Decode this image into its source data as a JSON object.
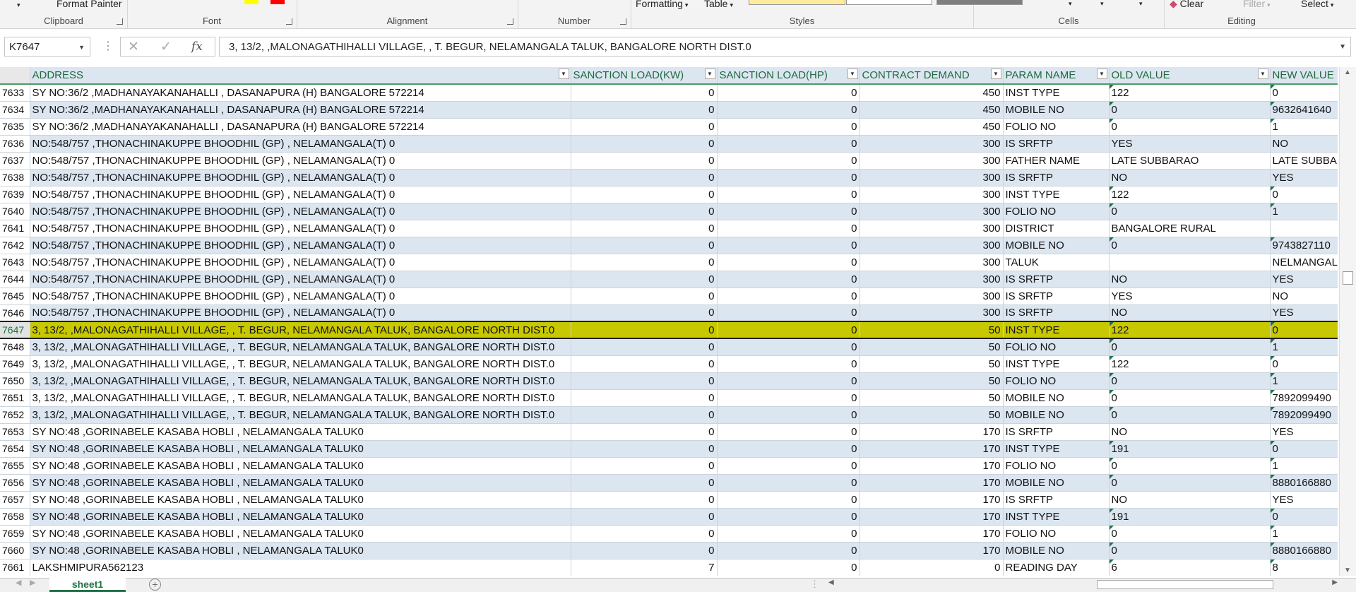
{
  "ribbon": {
    "clipboard": {
      "label": "Clipboard",
      "format_painter": "Format Painter"
    },
    "font": {
      "label": "Font"
    },
    "alignment": {
      "label": "Alignment"
    },
    "number": {
      "label": "Number"
    },
    "styles": {
      "label": "Styles",
      "conditional_formatting": "Formatting",
      "format_as_table": "Table"
    },
    "cells": {
      "label": "Cells"
    },
    "editing": {
      "label": "Editing",
      "clear": "Clear",
      "filter": "Filter",
      "select": "Select"
    }
  },
  "formula_bar": {
    "name_box": "K7647",
    "content": "3, 13/2,  ,MALONAGATHIHALLI VILLAGE,  , T. BEGUR, NELAMANGALA TALUK, BANGALORE NORTH DIST.0"
  },
  "columns": [
    "ADDRESS",
    "SANCTION LOAD(KW)",
    "SANCTION LOAD(HP)",
    "CONTRACT DEMAND",
    "PARAM NAME",
    "OLD VALUE",
    "NEW VALUE"
  ],
  "selected_row": "7647",
  "rows": [
    {
      "n": "7633",
      "addr": "SY NO:36/2  ,MADHANAYAKANAHALLI   , DASANAPURA (H) BANGALORE 572214",
      "kw": "0",
      "hp": "0",
      "cd": "450",
      "param": "INST TYPE",
      "old": "122",
      "new": "0",
      "old_txt": true,
      "new_txt": true
    },
    {
      "n": "7634",
      "addr": "SY NO:36/2  ,MADHANAYAKANAHALLI   , DASANAPURA (H) BANGALORE 572214",
      "kw": "0",
      "hp": "0",
      "cd": "450",
      "param": "MOBILE NO",
      "old": "0",
      "new": "9632641640",
      "old_txt": true,
      "new_txt": true
    },
    {
      "n": "7635",
      "addr": "SY NO:36/2  ,MADHANAYAKANAHALLI   , DASANAPURA (H) BANGALORE 572214",
      "kw": "0",
      "hp": "0",
      "cd": "450",
      "param": "FOLIO NO",
      "old": "0",
      "new": "1",
      "old_txt": true,
      "new_txt": true
    },
    {
      "n": "7636",
      "addr": "NO:548/757 ,THONACHINAKUPPE BHOODHIL (GP)  , NELAMANGALA(T) 0",
      "kw": "0",
      "hp": "0",
      "cd": "300",
      "param": "IS SRFTP",
      "old": "YES",
      "new": "NO",
      "old_txt": false,
      "new_txt": false
    },
    {
      "n": "7637",
      "addr": "NO:548/757 ,THONACHINAKUPPE BHOODHIL (GP)  , NELAMANGALA(T) 0",
      "kw": "0",
      "hp": "0",
      "cd": "300",
      "param": "FATHER NAME",
      "old": "LATE SUBBARAO",
      "new": "LATE SUBBAR",
      "old_txt": false,
      "new_txt": false
    },
    {
      "n": "7638",
      "addr": "NO:548/757 ,THONACHINAKUPPE BHOODHIL (GP)  , NELAMANGALA(T) 0",
      "kw": "0",
      "hp": "0",
      "cd": "300",
      "param": "IS SRFTP",
      "old": "NO",
      "new": "YES",
      "old_txt": false,
      "new_txt": false
    },
    {
      "n": "7639",
      "addr": "NO:548/757 ,THONACHINAKUPPE BHOODHIL (GP)  , NELAMANGALA(T) 0",
      "kw": "0",
      "hp": "0",
      "cd": "300",
      "param": "INST TYPE",
      "old": "122",
      "new": "0",
      "old_txt": true,
      "new_txt": true
    },
    {
      "n": "7640",
      "addr": "NO:548/757 ,THONACHINAKUPPE BHOODHIL (GP)  , NELAMANGALA(T) 0",
      "kw": "0",
      "hp": "0",
      "cd": "300",
      "param": "FOLIO NO",
      "old": "0",
      "new": "1",
      "old_txt": true,
      "new_txt": true
    },
    {
      "n": "7641",
      "addr": "NO:548/757 ,THONACHINAKUPPE BHOODHIL (GP)  , NELAMANGALA(T) 0",
      "kw": "0",
      "hp": "0",
      "cd": "300",
      "param": "DISTRICT",
      "old": "BANGALORE RURAL",
      "new": "",
      "old_txt": false,
      "new_txt": false
    },
    {
      "n": "7642",
      "addr": "NO:548/757 ,THONACHINAKUPPE BHOODHIL (GP)  , NELAMANGALA(T) 0",
      "kw": "0",
      "hp": "0",
      "cd": "300",
      "param": "MOBILE NO",
      "old": "0",
      "new": "9743827110",
      "old_txt": true,
      "new_txt": true
    },
    {
      "n": "7643",
      "addr": "NO:548/757 ,THONACHINAKUPPE BHOODHIL (GP)  , NELAMANGALA(T) 0",
      "kw": "0",
      "hp": "0",
      "cd": "300",
      "param": "TALUK",
      "old": "",
      "new": "NELMANGAL",
      "old_txt": false,
      "new_txt": false
    },
    {
      "n": "7644",
      "addr": "NO:548/757 ,THONACHINAKUPPE BHOODHIL (GP)  , NELAMANGALA(T) 0",
      "kw": "0",
      "hp": "0",
      "cd": "300",
      "param": "IS SRFTP",
      "old": "NO",
      "new": "YES",
      "old_txt": false,
      "new_txt": false
    },
    {
      "n": "7645",
      "addr": "NO:548/757 ,THONACHINAKUPPE BHOODHIL (GP)  , NELAMANGALA(T) 0",
      "kw": "0",
      "hp": "0",
      "cd": "300",
      "param": "IS SRFTP",
      "old": "YES",
      "new": "NO",
      "old_txt": false,
      "new_txt": false
    },
    {
      "n": "7646",
      "addr": "NO:548/757 ,THONACHINAKUPPE BHOODHIL (GP)  , NELAMANGALA(T) 0",
      "kw": "0",
      "hp": "0",
      "cd": "300",
      "param": "IS SRFTP",
      "old": "NO",
      "new": "YES",
      "old_txt": false,
      "new_txt": false
    },
    {
      "n": "7647",
      "addr": "3, 13/2,  ,MALONAGATHIHALLI VILLAGE,  , T. BEGUR, NELAMANGALA TALUK, BANGALORE NORTH DIST.0",
      "kw": "0",
      "hp": "0",
      "cd": "50",
      "param": "INST TYPE",
      "old": "122",
      "new": "0",
      "old_txt": true,
      "new_txt": true
    },
    {
      "n": "7648",
      "addr": "3, 13/2,  ,MALONAGATHIHALLI VILLAGE,  , T. BEGUR, NELAMANGALA TALUK, BANGALORE NORTH DIST.0",
      "kw": "0",
      "hp": "0",
      "cd": "50",
      "param": "FOLIO NO",
      "old": "0",
      "new": "1",
      "old_txt": true,
      "new_txt": true
    },
    {
      "n": "7649",
      "addr": "3, 13/2,  ,MALONAGATHIHALLI VILLAGE,  , T. BEGUR, NELAMANGALA TALUK, BANGALORE NORTH DIST.0",
      "kw": "0",
      "hp": "0",
      "cd": "50",
      "param": "INST TYPE",
      "old": "122",
      "new": "0",
      "old_txt": true,
      "new_txt": true
    },
    {
      "n": "7650",
      "addr": "3, 13/2,  ,MALONAGATHIHALLI VILLAGE,  , T. BEGUR, NELAMANGALA TALUK, BANGALORE NORTH DIST.0",
      "kw": "0",
      "hp": "0",
      "cd": "50",
      "param": "FOLIO NO",
      "old": "0",
      "new": "1",
      "old_txt": true,
      "new_txt": true
    },
    {
      "n": "7651",
      "addr": "3, 13/2,  ,MALONAGATHIHALLI VILLAGE,  , T. BEGUR, NELAMANGALA TALUK, BANGALORE NORTH DIST.0",
      "kw": "0",
      "hp": "0",
      "cd": "50",
      "param": "MOBILE NO",
      "old": "0",
      "new": "7892099490",
      "old_txt": true,
      "new_txt": true
    },
    {
      "n": "7652",
      "addr": "3, 13/2,  ,MALONAGATHIHALLI VILLAGE,  , T. BEGUR, NELAMANGALA TALUK, BANGALORE NORTH DIST.0",
      "kw": "0",
      "hp": "0",
      "cd": "50",
      "param": "MOBILE NO",
      "old": "0",
      "new": "7892099490",
      "old_txt": true,
      "new_txt": true
    },
    {
      "n": "7653",
      "addr": "SY NO:48  ,GORINABELE KASABA HOBLI  , NELAMANGALA TALUK0",
      "kw": "0",
      "hp": "0",
      "cd": "170",
      "param": "IS SRFTP",
      "old": "NO",
      "new": "YES",
      "old_txt": false,
      "new_txt": false
    },
    {
      "n": "7654",
      "addr": "SY NO:48  ,GORINABELE KASABA HOBLI  , NELAMANGALA TALUK0",
      "kw": "0",
      "hp": "0",
      "cd": "170",
      "param": "INST TYPE",
      "old": "191",
      "new": "0",
      "old_txt": true,
      "new_txt": true
    },
    {
      "n": "7655",
      "addr": "SY NO:48  ,GORINABELE KASABA HOBLI  , NELAMANGALA TALUK0",
      "kw": "0",
      "hp": "0",
      "cd": "170",
      "param": "FOLIO NO",
      "old": "0",
      "new": "1",
      "old_txt": true,
      "new_txt": true
    },
    {
      "n": "7656",
      "addr": "SY NO:48  ,GORINABELE KASABA HOBLI  , NELAMANGALA TALUK0",
      "kw": "0",
      "hp": "0",
      "cd": "170",
      "param": "MOBILE NO",
      "old": "0",
      "new": "8880166880",
      "old_txt": true,
      "new_txt": true
    },
    {
      "n": "7657",
      "addr": "SY NO:48  ,GORINABELE KASABA HOBLI  , NELAMANGALA TALUK0",
      "kw": "0",
      "hp": "0",
      "cd": "170",
      "param": "IS SRFTP",
      "old": "NO",
      "new": "YES",
      "old_txt": false,
      "new_txt": false
    },
    {
      "n": "7658",
      "addr": "SY NO:48  ,GORINABELE KASABA HOBLI  , NELAMANGALA TALUK0",
      "kw": "0",
      "hp": "0",
      "cd": "170",
      "param": "INST TYPE",
      "old": "191",
      "new": "0",
      "old_txt": true,
      "new_txt": true
    },
    {
      "n": "7659",
      "addr": "SY NO:48  ,GORINABELE KASABA HOBLI  , NELAMANGALA TALUK0",
      "kw": "0",
      "hp": "0",
      "cd": "170",
      "param": "FOLIO NO",
      "old": "0",
      "new": "1",
      "old_txt": true,
      "new_txt": true
    },
    {
      "n": "7660",
      "addr": "SY NO:48  ,GORINABELE KASABA HOBLI  , NELAMANGALA TALUK0",
      "kw": "0",
      "hp": "0",
      "cd": "170",
      "param": "MOBILE NO",
      "old": "0",
      "new": "8880166880",
      "old_txt": true,
      "new_txt": true
    },
    {
      "n": "7661",
      "addr": "LAKSHMIPURA562123",
      "kw": "7",
      "hp": "0",
      "cd": "0",
      "param": "READING DAY",
      "old": "6",
      "new": "8",
      "old_txt": true,
      "new_txt": true
    }
  ],
  "sheet_tabs": [
    "sheet1"
  ],
  "colors": {
    "header_text": "#1f6a3a",
    "band": "#dce6f1",
    "selected_row": "#c8c800",
    "accent": "#1e7145"
  }
}
